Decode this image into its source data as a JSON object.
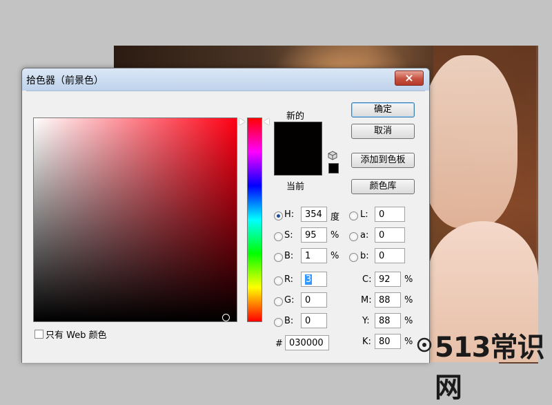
{
  "dialog": {
    "title": "拾色器（前景色）",
    "close_icon": "×"
  },
  "preview": {
    "new_label": "新的",
    "current_label": "当前",
    "new_color": "#030000",
    "current_color": "#030000"
  },
  "buttons": {
    "ok": "确定",
    "cancel": "取消",
    "add_to_swatches": "添加到色板",
    "color_libraries": "颜色库"
  },
  "web_only": {
    "label": "只有 Web 颜色",
    "checked": false
  },
  "hsb": {
    "h_label": "H:",
    "h_value": "354",
    "h_unit": "度",
    "h_selected": true,
    "s_label": "S:",
    "s_value": "95",
    "s_unit": "%",
    "b_label": "B:",
    "b_value": "1",
    "b_unit": "%"
  },
  "lab": {
    "l_label": "L:",
    "l_value": "0",
    "a_label": "a:",
    "a_value": "0",
    "b_label": "b:",
    "b_value": "0"
  },
  "rgb": {
    "r_label": "R:",
    "r_value": "3",
    "g_label": "G:",
    "g_value": "0",
    "b_label": "B:",
    "b_value": "0"
  },
  "cmyk": {
    "c_label": "C:",
    "c_value": "92",
    "c_unit": "%",
    "m_label": "M:",
    "m_value": "88",
    "m_unit": "%",
    "y_label": "Y:",
    "y_value": "88",
    "y_unit": "%",
    "k_label": "K:",
    "k_value": "80",
    "k_unit": "%"
  },
  "hex": {
    "label": "#",
    "value": "030000"
  },
  "watermark": {
    "text": "513常识网"
  },
  "colors": {
    "field_hue": "#ff0014",
    "title_gradient_top": "#dbe7f5",
    "close_red": "#c65140"
  }
}
